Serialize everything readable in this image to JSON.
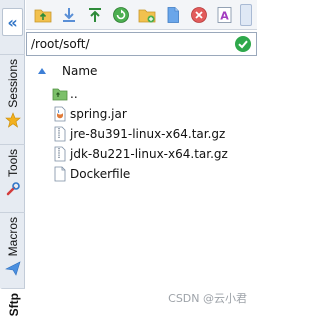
{
  "toolbar": {
    "buttons": [
      "back-folder",
      "download",
      "upload",
      "refresh",
      "new-folder",
      "new-file",
      "delete",
      "rename"
    ]
  },
  "path": {
    "value": "/root/soft/"
  },
  "file_list": {
    "column_name": "Name",
    "items": [
      {
        "name": "..",
        "type": "parent-folder-icon"
      },
      {
        "name": "spring.jar",
        "type": "jar-file-icon"
      },
      {
        "name": "jre-8u391-linux-x64.tar.gz",
        "type": "archive-file-icon"
      },
      {
        "name": "jdk-8u221-linux-x64.tar.gz",
        "type": "archive-file-icon"
      },
      {
        "name": "Dockerfile",
        "type": "file-icon"
      }
    ]
  },
  "sidebar": {
    "tabs": [
      {
        "label": "Sessions",
        "icon": "star-icon"
      },
      {
        "label": "Tools",
        "icon": "wrench-icon"
      },
      {
        "label": "Macros",
        "icon": "send-icon"
      },
      {
        "label": "Sftp",
        "icon": "sftp-icon"
      }
    ]
  },
  "watermark": "CSDN @云小君",
  "colors": {
    "accent": "#2f74c7",
    "ok": "#2ea84b",
    "delete": "#e25b5b"
  }
}
